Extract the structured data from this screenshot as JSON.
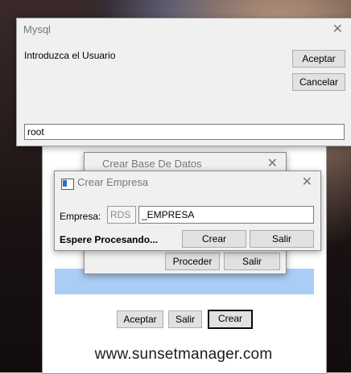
{
  "mysql_dialog": {
    "title": "Mysql",
    "prompt": "Introduzca el Usuario",
    "accept_label": "Aceptar",
    "cancel_label": "Cancelar",
    "input_value": "root"
  },
  "crear_bd_dialog": {
    "title": "Crear Base De Datos",
    "proceed_label": "Proceder",
    "exit_label": "Salir"
  },
  "crear_empresa_dialog": {
    "title": "Crear Empresa",
    "empresa_label": "Empresa:",
    "prefix_value": "RDS",
    "empresa_value": "_EMPRESA",
    "status_text": "Espere Procesando...",
    "create_label": "Crear",
    "exit_label": "Salir"
  },
  "main_window": {
    "accept_label": "Aceptar",
    "exit_label": "Salir",
    "create_label": "Crear",
    "url_text": "www.sunsetmanager.com"
  },
  "colors": {
    "progress_bar": "#a9cdf5",
    "dialog_bg": "#f0f0f0"
  }
}
